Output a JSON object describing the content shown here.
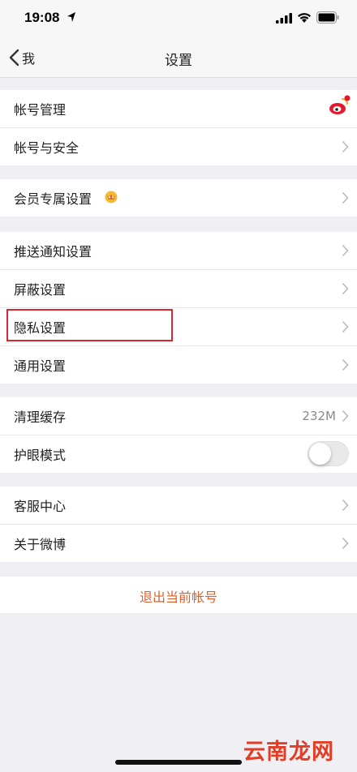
{
  "status_bar": {
    "time": "19:08"
  },
  "nav": {
    "back_label": "我",
    "title": "设置"
  },
  "groups": {
    "account": [
      {
        "label": "帐号管理"
      },
      {
        "label": "帐号与安全"
      }
    ],
    "member": [
      {
        "label": "会员专属设置"
      }
    ],
    "settings": [
      {
        "label": "推送通知设置"
      },
      {
        "label": "屏蔽设置"
      },
      {
        "label": "隐私设置"
      },
      {
        "label": "通用设置"
      }
    ],
    "storage": [
      {
        "label": "清理缓存",
        "value": "232M"
      },
      {
        "label": "护眼模式",
        "toggle_on": false
      }
    ],
    "help": [
      {
        "label": "客服中心"
      },
      {
        "label": "关于微博"
      }
    ]
  },
  "logout_label": "退出当前帐号",
  "watermark": "云南龙网",
  "colors": {
    "accent": "#e0602b",
    "highlight": "#d8282d",
    "background": "#efeff4"
  }
}
